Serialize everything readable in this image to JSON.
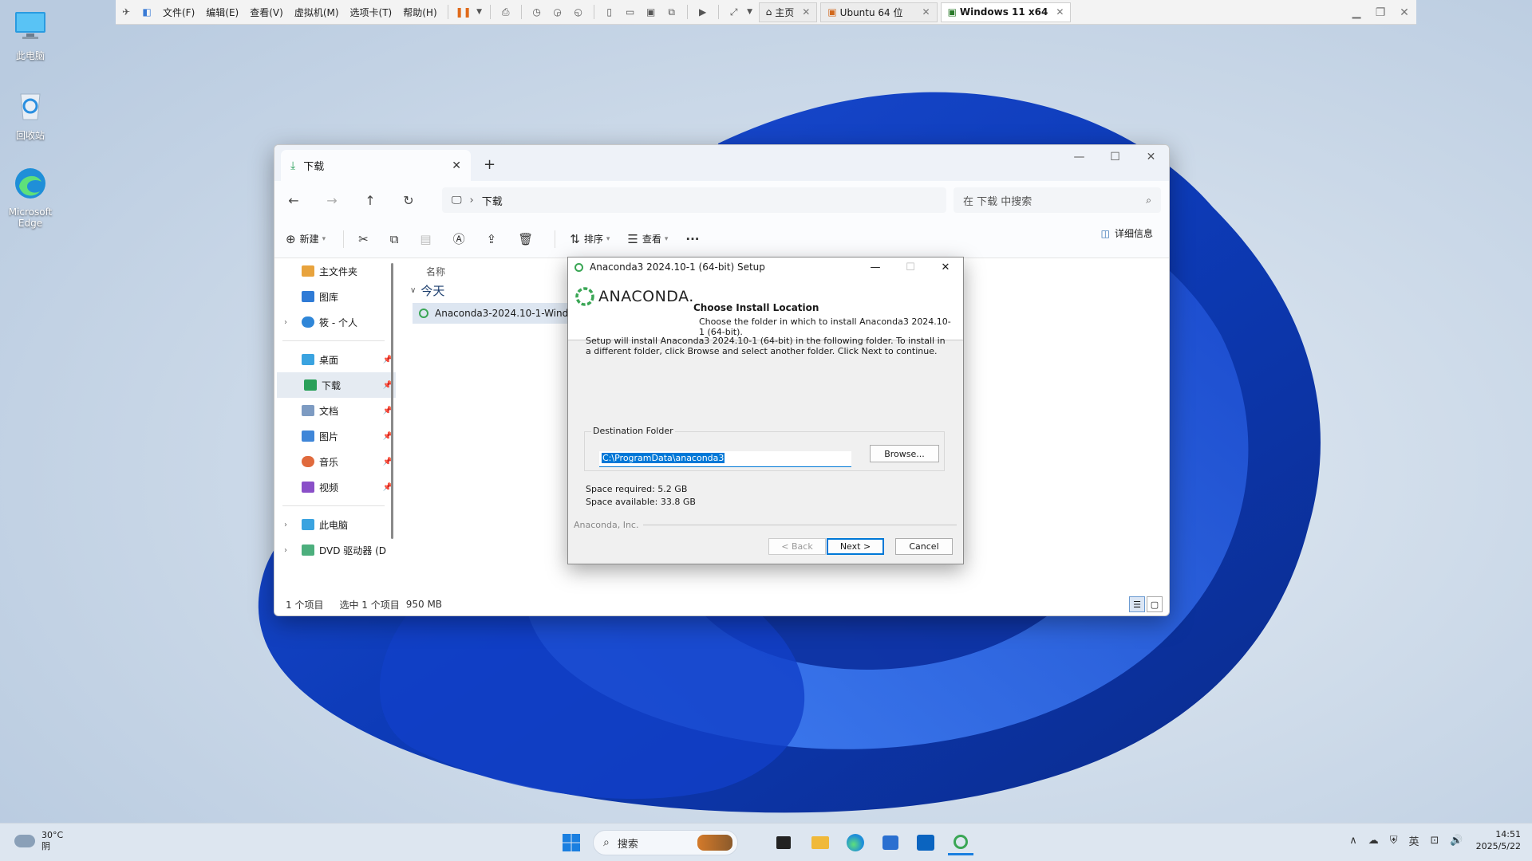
{
  "desktop": {
    "icons": [
      {
        "label": "此电脑"
      },
      {
        "label": "回收站"
      },
      {
        "label": "Microsoft Edge"
      }
    ]
  },
  "vmware": {
    "menus": [
      "文件(F)",
      "编辑(E)",
      "查看(V)",
      "虚拟机(M)",
      "选项卡(T)",
      "帮助(H)"
    ],
    "tabs": [
      {
        "label": "主页",
        "active": false
      },
      {
        "label": "Ubuntu 64 位",
        "active": false
      },
      {
        "label": "Windows 11 x64",
        "active": true
      }
    ]
  },
  "explorer": {
    "tab_title": "下载",
    "breadcrumb": "下载",
    "search_placeholder": "在 下载 中搜索",
    "commands": {
      "new": "新建",
      "sort": "排序",
      "view": "查看",
      "details": "详细信息"
    },
    "sidebar": {
      "top": [
        {
          "label": "主文件夹",
          "color": "#e8a33d",
          "has_arrow": false
        },
        {
          "label": "图库",
          "color": "#2f7bd6",
          "has_arrow": false
        },
        {
          "label": "筱 - 个人",
          "color": "#2f86d8",
          "has_arrow": true
        }
      ],
      "pinned": [
        {
          "label": "桌面",
          "color": "#3aa3e0"
        },
        {
          "label": "下载",
          "color": "#2aa05a",
          "selected": true
        },
        {
          "label": "文档",
          "color": "#7d9bc2"
        },
        {
          "label": "图片",
          "color": "#3f86d8"
        },
        {
          "label": "音乐",
          "color": "#e06a3d"
        },
        {
          "label": "视频",
          "color": "#8a4fc8"
        }
      ],
      "bottom": [
        {
          "label": "此电脑",
          "color": "#3aa3e0"
        },
        {
          "label": "DVD 驱动器 (D",
          "color": "#4caf7d"
        }
      ]
    },
    "column_name": "名称",
    "group_today": "今天",
    "file_name": "Anaconda3-2024.10-1-Windows-x86_64.exe",
    "status": {
      "count": "1 个项目",
      "selected": "选中 1 个项目",
      "size": "950 MB"
    }
  },
  "setup": {
    "title": "Anaconda3 2024.10-1 (64-bit) Setup",
    "logo_text": "ANACONDA.",
    "header_title": "Choose Install Location",
    "header_sub": "Choose the folder in which to install Anaconda3 2024.10-1 (64-bit).",
    "body": "Setup will install Anaconda3 2024.10-1 (64-bit) in the following folder. To install in a different folder, click Browse and select another folder. Click Next to continue.",
    "dest_label": "Destination Folder",
    "dest_path": "C:\\ProgramData\\anaconda3",
    "browse": "Browse...",
    "space_required": "Space required: 5.2 GB",
    "space_available": "Space available: 33.8 GB",
    "brand": "Anaconda, Inc.",
    "back": "< Back",
    "next": "Next >",
    "cancel": "Cancel"
  },
  "taskbar": {
    "weather_temp": "30°C",
    "weather_desc": "阴",
    "search_label": "搜索",
    "tray_lang": "英",
    "time": "14:51",
    "date": "2025/5/22"
  }
}
